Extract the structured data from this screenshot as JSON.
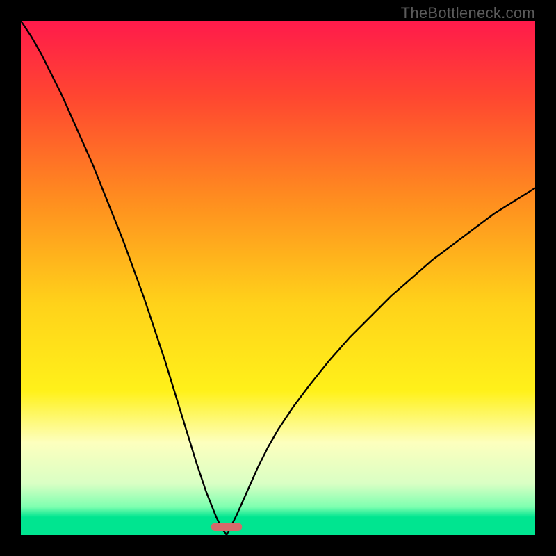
{
  "watermark": "TheBottleneck.com",
  "chart_data": {
    "type": "line",
    "title": "",
    "xlabel": "",
    "ylabel": "",
    "xlim": [
      0,
      100
    ],
    "ylim": [
      0,
      100
    ],
    "gradient_stops": [
      {
        "t": 0.0,
        "color": "#ff1a4b"
      },
      {
        "t": 0.15,
        "color": "#ff4730"
      },
      {
        "t": 0.35,
        "color": "#ff8e1f"
      },
      {
        "t": 0.55,
        "color": "#ffd21a"
      },
      {
        "t": 0.72,
        "color": "#fff11a"
      },
      {
        "t": 0.82,
        "color": "#fdffbe"
      },
      {
        "t": 0.9,
        "color": "#d9ffc4"
      },
      {
        "t": 0.945,
        "color": "#7effb0"
      },
      {
        "t": 0.965,
        "color": "#00e590"
      },
      {
        "t": 1.0,
        "color": "#00e590"
      }
    ],
    "marker": {
      "x": 40,
      "width": 6,
      "color": "#d46a6a"
    },
    "series": [
      {
        "name": "left",
        "x": [
          0,
          2,
          4,
          6,
          8,
          10,
          12,
          14,
          16,
          18,
          20,
          22,
          24,
          26,
          28,
          30,
          32,
          34,
          36,
          38,
          39,
          39.7,
          40
        ],
        "y": [
          100,
          97,
          93.5,
          89.5,
          85.5,
          81,
          76.5,
          72,
          67,
          62,
          57,
          51.5,
          46,
          40,
          34,
          27.5,
          21,
          14.5,
          8.5,
          3.5,
          1.5,
          0.5,
          0
        ]
      },
      {
        "name": "right",
        "x": [
          40,
          40.5,
          41,
          42,
          44,
          46,
          48,
          50,
          53,
          56,
          60,
          64,
          68,
          72,
          76,
          80,
          84,
          88,
          92,
          96,
          100
        ],
        "y": [
          0,
          1,
          2,
          4,
          8.5,
          13,
          17,
          20.5,
          25,
          29,
          34,
          38.5,
          42.5,
          46.5,
          50,
          53.5,
          56.5,
          59.5,
          62.5,
          65,
          67.5
        ]
      }
    ]
  }
}
